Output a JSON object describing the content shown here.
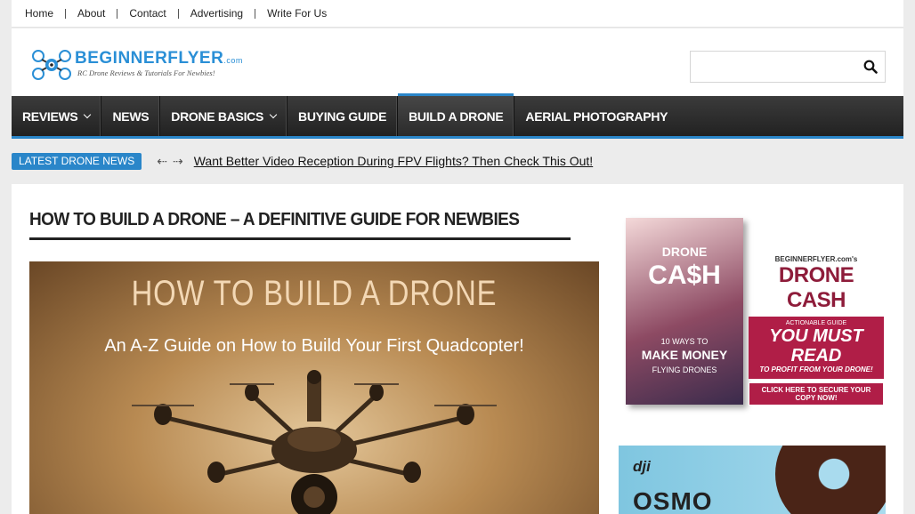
{
  "topnav": [
    "Home",
    "About",
    "Contact",
    "Advertising",
    "Write For Us"
  ],
  "logo": {
    "title": "BEGINNERFLYER",
    "suffix": ".com",
    "tagline": "RC Drone Reviews & Tutorials For Newbies!"
  },
  "search": {
    "placeholder": "",
    "icon": "search-icon"
  },
  "mainnav": [
    {
      "label": "REVIEWS",
      "dropdown": true
    },
    {
      "label": "NEWS",
      "dropdown": false
    },
    {
      "label": "DRONE BASICS",
      "dropdown": true
    },
    {
      "label": "BUYING GUIDE",
      "dropdown": false
    },
    {
      "label": "BUILD A DRONE",
      "dropdown": false,
      "active": true
    },
    {
      "label": "AERIAL PHOTOGRAPHY",
      "dropdown": false
    }
  ],
  "ticker": {
    "label": "LATEST DRONE NEWS",
    "headline": "Want Better Video Reception During FPV Flights? Then Check This Out!"
  },
  "post": {
    "title": "HOW TO BUILD A DRONE – A DEFINITIVE GUIDE FOR NEWBIES",
    "hero_title": "HOW TO BUILD A DRONE",
    "hero_subtitle": "An A-Z Guide on How to Build Your First Quadcopter!"
  },
  "ad_book": {
    "cover_line1": "DRONE",
    "cover_line2": "CA$H",
    "cover_line3": "10 WAYS TO",
    "cover_line4": "MAKE MONEY",
    "cover_line5": "FLYING DRONES",
    "brand": "BEGINNERFLYER.com's",
    "headline": "DRONE CASH",
    "sub1": "ACTIONABLE GUIDE",
    "sub2": "YOU MUST READ",
    "sub3": "TO PROFIT FROM YOUR DRONE!",
    "cta": "CLICK HERE TO SECURE YOUR COPY NOW!"
  },
  "ad_dji": {
    "brand": "dji",
    "product": "OSMO"
  },
  "colors": {
    "accent": "#2a86c9",
    "nav_bg": "#2b2b2b",
    "ad_red": "#b01e47"
  }
}
